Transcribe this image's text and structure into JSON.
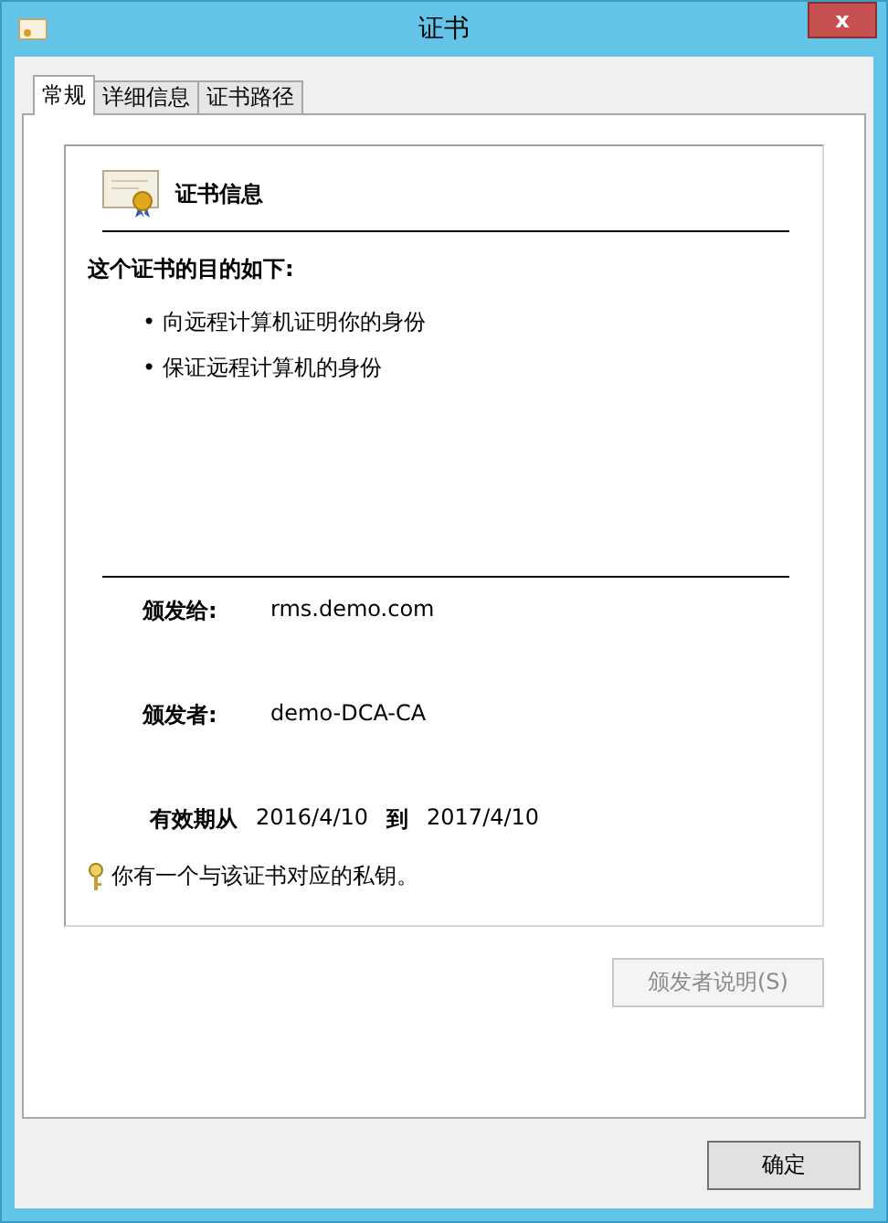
{
  "window": {
    "title": "证书",
    "close": "x"
  },
  "tabs": [
    {
      "label": "常规",
      "selected": true
    },
    {
      "label": "详细信息",
      "selected": false
    },
    {
      "label": "证书路径",
      "selected": false
    }
  ],
  "info_title": "证书信息",
  "purpose_heading": "这个证书的目的如下:",
  "purposes": [
    "• 向远程计算机证明你的身份",
    "• 保证远程计算机的身份"
  ],
  "issued_to": {
    "label": "颁发给:",
    "value": "rms.demo.com"
  },
  "issued_by": {
    "label": "颁发者:",
    "value": "demo-DCA-CA"
  },
  "validity": {
    "from_label": "有效期从",
    "from": "2016/4/10",
    "to_label": "到",
    "to": "2017/4/10"
  },
  "private_key_note": "你有一个与该证书对应的私钥。",
  "issuer_statement_button": {
    "label": "颁发者说明(S)",
    "disabled": true
  },
  "ok_button": "确定"
}
